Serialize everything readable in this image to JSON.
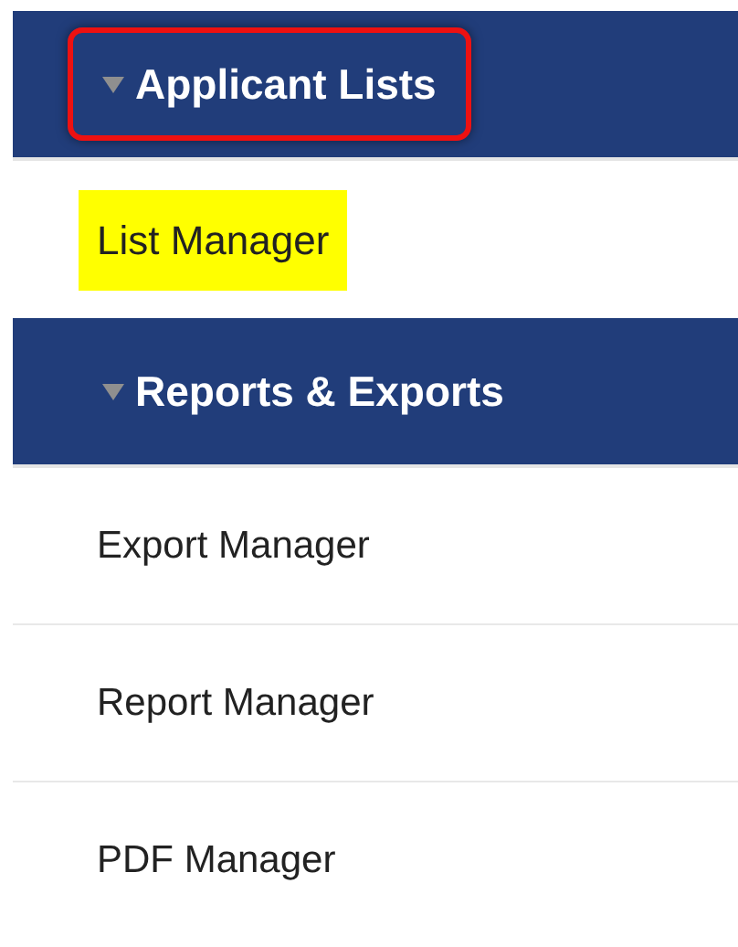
{
  "sections": [
    {
      "title": "Applicant Lists",
      "expanded": true,
      "outlined": true,
      "items": [
        {
          "label": "List Manager",
          "highlighted": true
        }
      ]
    },
    {
      "title": "Reports & Exports",
      "expanded": true,
      "outlined": false,
      "items": [
        {
          "label": "Export Manager",
          "highlighted": false
        },
        {
          "label": "Report Manager",
          "highlighted": false
        },
        {
          "label": "PDF Manager",
          "highlighted": false
        }
      ]
    }
  ]
}
